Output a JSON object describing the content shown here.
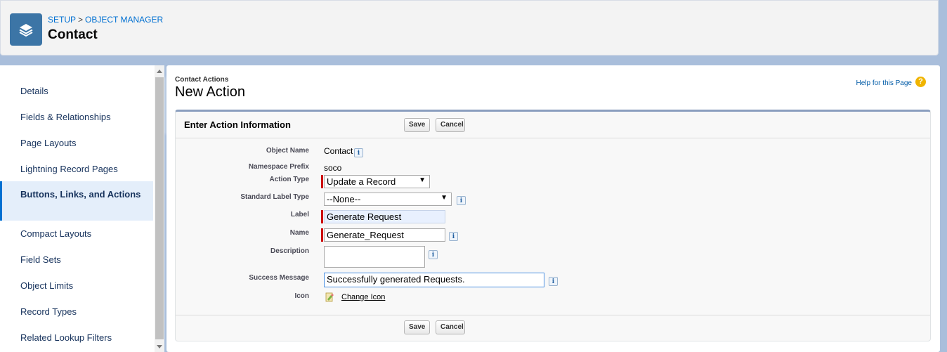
{
  "header": {
    "breadcrumb": [
      "SETUP",
      "OBJECT MANAGER"
    ],
    "breadcrumb_sep": ">",
    "title": "Contact",
    "icon": "stack-layers-icon"
  },
  "sidebar": {
    "items": [
      {
        "label": "Details"
      },
      {
        "label": "Fields & Relationships"
      },
      {
        "label": "Page Layouts"
      },
      {
        "label": "Lightning Record Pages"
      },
      {
        "label": "Buttons, Links, and Actions",
        "active": true
      },
      {
        "label": "Compact Layouts"
      },
      {
        "label": "Field Sets"
      },
      {
        "label": "Object Limits"
      },
      {
        "label": "Record Types"
      },
      {
        "label": "Related Lookup Filters"
      }
    ]
  },
  "main": {
    "section_label": "Contact Actions",
    "title": "New Action",
    "help_link": "Help for this Page",
    "help_icon": "?",
    "panel": {
      "title": "Enter Action Information",
      "save_label": "Save",
      "cancel_label": "Cancel"
    },
    "form": {
      "object_name_label": "Object Name",
      "object_name_value": "Contact",
      "namespace_label": "Namespace Prefix",
      "namespace_value": "soco",
      "action_type_label": "Action Type",
      "action_type_value": "Update a Record",
      "standard_label_type_label": "Standard Label Type",
      "standard_label_type_value": "--None--",
      "label_label": "Label",
      "label_value": "Generate Request",
      "name_label": "Name",
      "name_value": "Generate_Request",
      "description_label": "Description",
      "description_value": "",
      "success_label": "Success Message",
      "success_value": "Successfully generated Requests.",
      "icon_label": "Icon",
      "change_icon_label": "Change Icon"
    },
    "info_glyph": "i"
  },
  "colors": {
    "accent": "#0070d2",
    "required": "#cc0000",
    "object_icon_bg": "#3c75a6"
  }
}
